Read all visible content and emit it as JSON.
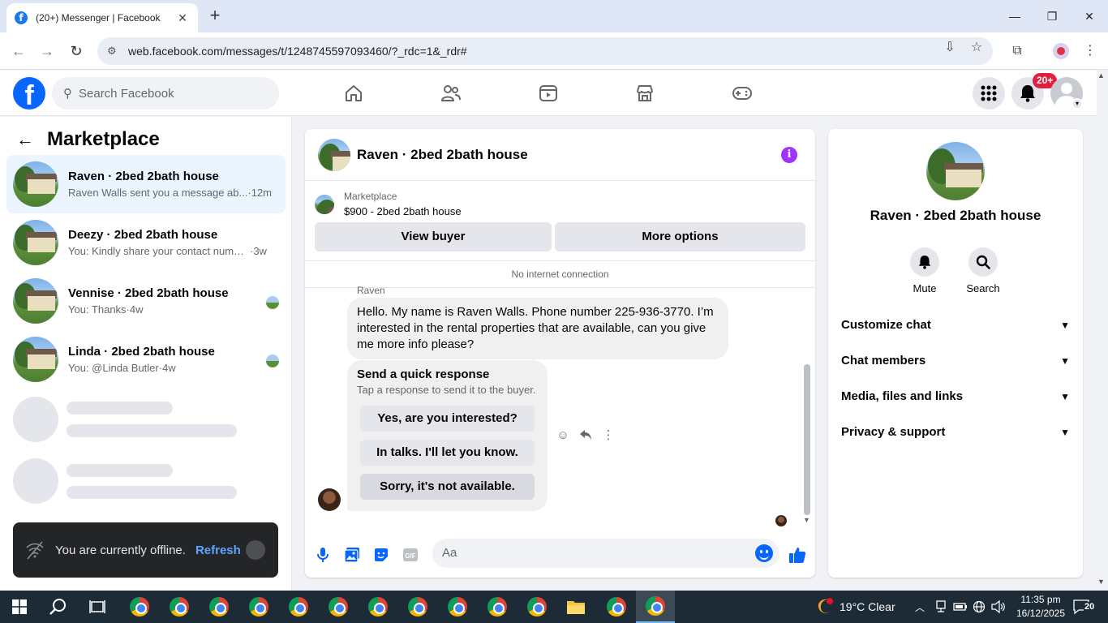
{
  "browser": {
    "tab_title": "(20+) Messenger | Facebook",
    "url": "web.facebook.com/messages/t/1248745597093460/?_rdc=1&_rdr#"
  },
  "fb_header": {
    "search_placeholder": "Search Facebook",
    "notification_badge": "20+"
  },
  "sidebar": {
    "title": "Marketplace",
    "conversations": [
      {
        "name": "Raven · 2bed 2bath house",
        "preview": "Raven Walls sent you a message ab...",
        "time": "·12m",
        "active": true
      },
      {
        "name": "Deezy · 2bed 2bath house",
        "preview": "You: Kindly share your contact numbe...",
        "time": "·3w",
        "active": false
      },
      {
        "name": "Vennise · 2bed 2bath house",
        "preview": "You: Thanks",
        "time": "·4w",
        "active": false
      },
      {
        "name": "Linda · 2bed 2bath house",
        "preview": "You: @Linda Butler",
        "time": "·4w",
        "active": false
      }
    ]
  },
  "toast": {
    "message": "You are currently offline.",
    "action": "Refresh"
  },
  "chat": {
    "title": "Raven · 2bed 2bath house",
    "listing_source": "Marketplace",
    "listing_title": "$900 - 2bed 2bath house",
    "view_buyer": "View buyer",
    "more_options": "More options",
    "connection_status": "No internet connection",
    "sender": "Raven",
    "message": "Hello. My name is Raven Walls. Phone number 225-936-3770. I’m interested in the rental properties that are available, can you give me more info please?",
    "quick_response": {
      "title": "Send a quick response",
      "subtitle": "Tap a response to send it to the buyer.",
      "options": [
        "Yes, are you interested?",
        "In talks. I'll let you know.",
        "Sorry, it's not available."
      ]
    },
    "composer_placeholder": "Aa"
  },
  "info_panel": {
    "name": "Raven · 2bed 2bath house",
    "mute": "Mute",
    "search": "Search",
    "sections": [
      "Customize chat",
      "Chat members",
      "Media, files and links",
      "Privacy & support"
    ]
  },
  "taskbar": {
    "weather": "19°C  Clear",
    "time": "11:35 pm",
    "date": "16/12/2025",
    "notifications": "20"
  }
}
